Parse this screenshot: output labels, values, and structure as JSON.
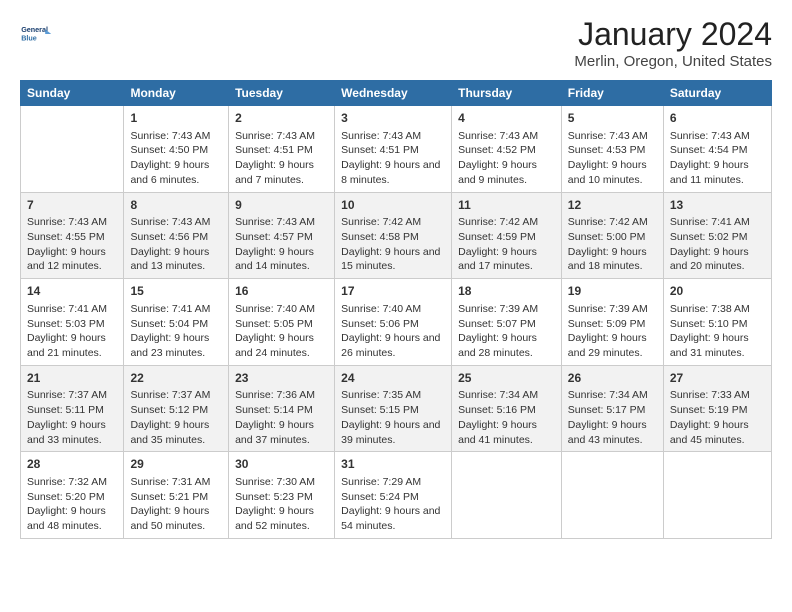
{
  "header": {
    "logo_line1": "General",
    "logo_line2": "Blue",
    "title": "January 2024",
    "subtitle": "Merlin, Oregon, United States"
  },
  "days_of_week": [
    "Sunday",
    "Monday",
    "Tuesday",
    "Wednesday",
    "Thursday",
    "Friday",
    "Saturday"
  ],
  "weeks": [
    [
      {
        "num": "",
        "sunrise": "",
        "sunset": "",
        "daylight": ""
      },
      {
        "num": "1",
        "sunrise": "Sunrise: 7:43 AM",
        "sunset": "Sunset: 4:50 PM",
        "daylight": "Daylight: 9 hours and 6 minutes."
      },
      {
        "num": "2",
        "sunrise": "Sunrise: 7:43 AM",
        "sunset": "Sunset: 4:51 PM",
        "daylight": "Daylight: 9 hours and 7 minutes."
      },
      {
        "num": "3",
        "sunrise": "Sunrise: 7:43 AM",
        "sunset": "Sunset: 4:51 PM",
        "daylight": "Daylight: 9 hours and 8 minutes."
      },
      {
        "num": "4",
        "sunrise": "Sunrise: 7:43 AM",
        "sunset": "Sunset: 4:52 PM",
        "daylight": "Daylight: 9 hours and 9 minutes."
      },
      {
        "num": "5",
        "sunrise": "Sunrise: 7:43 AM",
        "sunset": "Sunset: 4:53 PM",
        "daylight": "Daylight: 9 hours and 10 minutes."
      },
      {
        "num": "6",
        "sunrise": "Sunrise: 7:43 AM",
        "sunset": "Sunset: 4:54 PM",
        "daylight": "Daylight: 9 hours and 11 minutes."
      }
    ],
    [
      {
        "num": "7",
        "sunrise": "Sunrise: 7:43 AM",
        "sunset": "Sunset: 4:55 PM",
        "daylight": "Daylight: 9 hours and 12 minutes."
      },
      {
        "num": "8",
        "sunrise": "Sunrise: 7:43 AM",
        "sunset": "Sunset: 4:56 PM",
        "daylight": "Daylight: 9 hours and 13 minutes."
      },
      {
        "num": "9",
        "sunrise": "Sunrise: 7:43 AM",
        "sunset": "Sunset: 4:57 PM",
        "daylight": "Daylight: 9 hours and 14 minutes."
      },
      {
        "num": "10",
        "sunrise": "Sunrise: 7:42 AM",
        "sunset": "Sunset: 4:58 PM",
        "daylight": "Daylight: 9 hours and 15 minutes."
      },
      {
        "num": "11",
        "sunrise": "Sunrise: 7:42 AM",
        "sunset": "Sunset: 4:59 PM",
        "daylight": "Daylight: 9 hours and 17 minutes."
      },
      {
        "num": "12",
        "sunrise": "Sunrise: 7:42 AM",
        "sunset": "Sunset: 5:00 PM",
        "daylight": "Daylight: 9 hours and 18 minutes."
      },
      {
        "num": "13",
        "sunrise": "Sunrise: 7:41 AM",
        "sunset": "Sunset: 5:02 PM",
        "daylight": "Daylight: 9 hours and 20 minutes."
      }
    ],
    [
      {
        "num": "14",
        "sunrise": "Sunrise: 7:41 AM",
        "sunset": "Sunset: 5:03 PM",
        "daylight": "Daylight: 9 hours and 21 minutes."
      },
      {
        "num": "15",
        "sunrise": "Sunrise: 7:41 AM",
        "sunset": "Sunset: 5:04 PM",
        "daylight": "Daylight: 9 hours and 23 minutes."
      },
      {
        "num": "16",
        "sunrise": "Sunrise: 7:40 AM",
        "sunset": "Sunset: 5:05 PM",
        "daylight": "Daylight: 9 hours and 24 minutes."
      },
      {
        "num": "17",
        "sunrise": "Sunrise: 7:40 AM",
        "sunset": "Sunset: 5:06 PM",
        "daylight": "Daylight: 9 hours and 26 minutes."
      },
      {
        "num": "18",
        "sunrise": "Sunrise: 7:39 AM",
        "sunset": "Sunset: 5:07 PM",
        "daylight": "Daylight: 9 hours and 28 minutes."
      },
      {
        "num": "19",
        "sunrise": "Sunrise: 7:39 AM",
        "sunset": "Sunset: 5:09 PM",
        "daylight": "Daylight: 9 hours and 29 minutes."
      },
      {
        "num": "20",
        "sunrise": "Sunrise: 7:38 AM",
        "sunset": "Sunset: 5:10 PM",
        "daylight": "Daylight: 9 hours and 31 minutes."
      }
    ],
    [
      {
        "num": "21",
        "sunrise": "Sunrise: 7:37 AM",
        "sunset": "Sunset: 5:11 PM",
        "daylight": "Daylight: 9 hours and 33 minutes."
      },
      {
        "num": "22",
        "sunrise": "Sunrise: 7:37 AM",
        "sunset": "Sunset: 5:12 PM",
        "daylight": "Daylight: 9 hours and 35 minutes."
      },
      {
        "num": "23",
        "sunrise": "Sunrise: 7:36 AM",
        "sunset": "Sunset: 5:14 PM",
        "daylight": "Daylight: 9 hours and 37 minutes."
      },
      {
        "num": "24",
        "sunrise": "Sunrise: 7:35 AM",
        "sunset": "Sunset: 5:15 PM",
        "daylight": "Daylight: 9 hours and 39 minutes."
      },
      {
        "num": "25",
        "sunrise": "Sunrise: 7:34 AM",
        "sunset": "Sunset: 5:16 PM",
        "daylight": "Daylight: 9 hours and 41 minutes."
      },
      {
        "num": "26",
        "sunrise": "Sunrise: 7:34 AM",
        "sunset": "Sunset: 5:17 PM",
        "daylight": "Daylight: 9 hours and 43 minutes."
      },
      {
        "num": "27",
        "sunrise": "Sunrise: 7:33 AM",
        "sunset": "Sunset: 5:19 PM",
        "daylight": "Daylight: 9 hours and 45 minutes."
      }
    ],
    [
      {
        "num": "28",
        "sunrise": "Sunrise: 7:32 AM",
        "sunset": "Sunset: 5:20 PM",
        "daylight": "Daylight: 9 hours and 48 minutes."
      },
      {
        "num": "29",
        "sunrise": "Sunrise: 7:31 AM",
        "sunset": "Sunset: 5:21 PM",
        "daylight": "Daylight: 9 hours and 50 minutes."
      },
      {
        "num": "30",
        "sunrise": "Sunrise: 7:30 AM",
        "sunset": "Sunset: 5:23 PM",
        "daylight": "Daylight: 9 hours and 52 minutes."
      },
      {
        "num": "31",
        "sunrise": "Sunrise: 7:29 AM",
        "sunset": "Sunset: 5:24 PM",
        "daylight": "Daylight: 9 hours and 54 minutes."
      },
      {
        "num": "",
        "sunrise": "",
        "sunset": "",
        "daylight": ""
      },
      {
        "num": "",
        "sunrise": "",
        "sunset": "",
        "daylight": ""
      },
      {
        "num": "",
        "sunrise": "",
        "sunset": "",
        "daylight": ""
      }
    ]
  ]
}
